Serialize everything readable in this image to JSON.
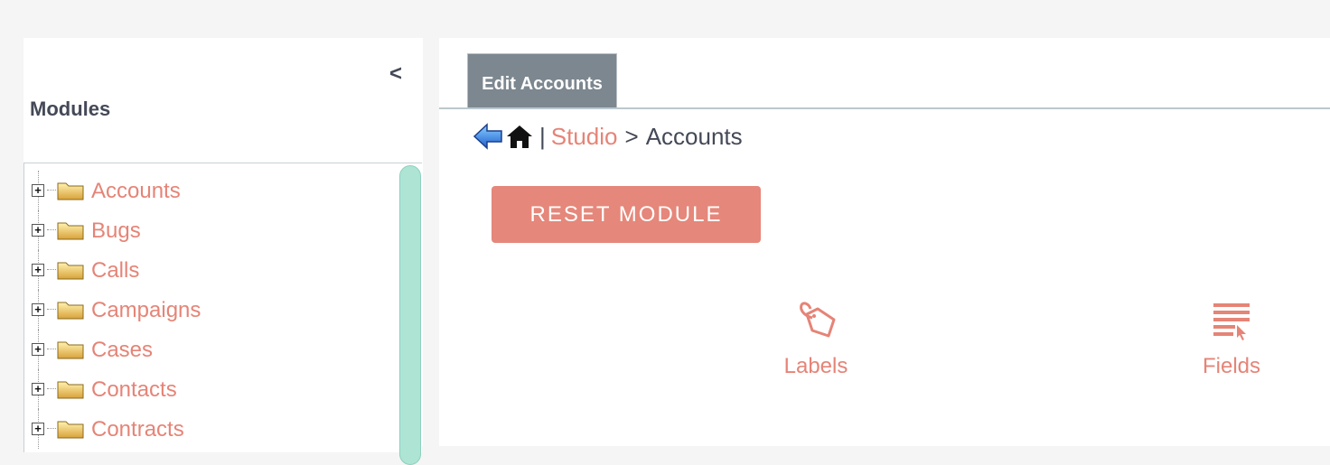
{
  "sidebar": {
    "collapse_glyph": "<",
    "title": "Modules",
    "items": [
      {
        "label": "Accounts"
      },
      {
        "label": "Bugs"
      },
      {
        "label": "Calls"
      },
      {
        "label": "Campaigns"
      },
      {
        "label": "Cases"
      },
      {
        "label": "Contacts"
      },
      {
        "label": "Contracts"
      }
    ]
  },
  "main": {
    "tab_label": "Edit Accounts",
    "breadcrumb": {
      "separator": "|",
      "studio": "Studio",
      "arrow": ">",
      "current": "Accounts"
    },
    "reset_button": "RESET MODULE",
    "studio_items": [
      {
        "label": "Labels",
        "icon": "tag-icon"
      },
      {
        "label": "Fields",
        "icon": "fields-icon"
      }
    ]
  },
  "colors": {
    "accent": "#e58477",
    "button": "#e5877a",
    "tab": "#7c878f",
    "scrollbar": "#ade4d4",
    "text_dark": "#444957"
  }
}
